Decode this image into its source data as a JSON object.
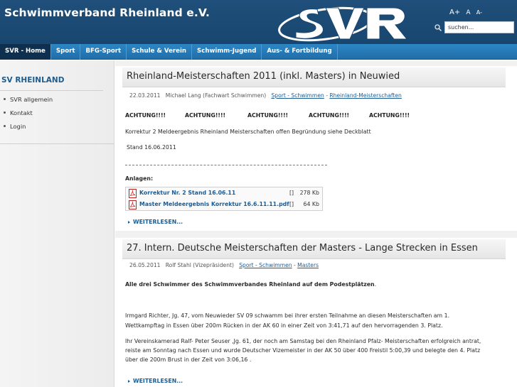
{
  "header": {
    "site_title": "Schwimmverband Rheinland e.V.",
    "logo_text": "SVR",
    "font_sizer": {
      "large": "A+",
      "normal": "A",
      "small": "A-"
    },
    "search": {
      "placeholder": "suchen..."
    }
  },
  "nav": {
    "items": [
      {
        "label": "SVR - Home",
        "active": true
      },
      {
        "label": "Sport",
        "active": false
      },
      {
        "label": "BFG-Sport",
        "active": false
      },
      {
        "label": "Schule & Verein",
        "active": false
      },
      {
        "label": "Schwimm-Jugend",
        "active": false
      },
      {
        "label": "Aus- & Fortbildung",
        "active": false
      }
    ]
  },
  "sidebar": {
    "heading": "SV RHEINLAND",
    "items": [
      {
        "label": "SVR allgemein"
      },
      {
        "label": "Kontakt"
      },
      {
        "label": "Login"
      }
    ]
  },
  "articles": [
    {
      "title": "Rheinland-Meisterschaften 2011 (inkl. Masters) in Neuwied",
      "date": "22.03.2011",
      "author": "Michael Lang (Fachwart Schwimmen)",
      "category": "Sport - Schwimmen",
      "separator": " - ",
      "subcategory": "Rheinland-Meisterschaften",
      "achtung": [
        "ACHTUNG!!!!",
        "ACHTUNG!!!!",
        "ACHTUNG!!!!",
        "ACHTUNG!!!!",
        "ACHTUNG!!!!"
      ],
      "body1": "Korrektur 2 Meldeergebnis Rheinland Meisterschaften offen Begründung siehe Deckblatt",
      "body2": "Stand 16.06.2011",
      "attachments_label": "Anlagen:",
      "attachments": [
        {
          "name": "Korrektur Nr. 2 Stand 16.06.11",
          "bracket": "[]",
          "size": "278 Kb"
        },
        {
          "name": "Master Meldeergebnis Korrektur 16.6.11.11.pdf",
          "bracket": "[]",
          "size": "64 Kb"
        }
      ],
      "readmore": "WEITERLESEN..."
    },
    {
      "title": "27. Intern. Deutsche Meisterschaften der Masters - Lange Strecken in Essen",
      "date": "26.05.2011",
      "author": "Rolf Stahl (Vizepräsident)",
      "category": "Sport - Schwimmen",
      "separator": " - ",
      "subcategory": "Masters",
      "lead": "Alle drei Schwimmer des Schwimmverbandes Rheinland auf dem Podestplätzen",
      "lead_end": ".",
      "para1_line1": "Irmgard Richter, Jg. 47, vom Neuwieder SV 09 schwamm bei ihrer ersten Teilnahme an diesen Meisterschaften am 1.",
      "para1_line2": "Wettkampftag in Essen über 200m Rücken in der AK 60 in einer Zeit von 3:41,71  auf den hervorragenden 3. Platz.",
      "para2_line1": "Ihr Vereinskamerad Ralf- Peter Seuser ,Jg. 61, der noch am Samstag bei den Rheinland Pfalz- Meisterschaften erfolgreich antrat,",
      "para2_line2": "reiste am Sonntag nach Essen und wurde Deutscher Vizemeister in der AK 50 über 400 Freistil 5:00,39 und belegte den 4. Platz",
      "para2_line3": "über die 200m Brust in der Zeit von 3:06,16 .",
      "readmore": "WEITERLESEN..."
    }
  ],
  "colors": {
    "header_bg": "#1f4f7a",
    "nav_bg": "#2e86c4",
    "nav_active": "#0f2f4e",
    "link": "#1a5c95",
    "sidebar_heading": "#1d5c8f"
  }
}
